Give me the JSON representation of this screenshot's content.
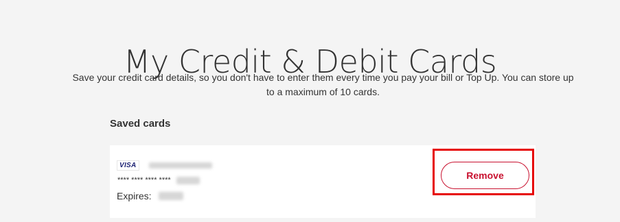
{
  "header": {
    "title": "My Credit & Debit Cards",
    "subtitle": "Save your credit card details, so you don't have to enter them every time you pay your bill or Top Up. You can store up to a maximum of 10 cards."
  },
  "saved_cards": {
    "heading": "Saved cards",
    "cards": [
      {
        "brand": "VISA",
        "masked_number": "**** **** **** ****",
        "expires_label": "Expires:",
        "remove_label": "Remove"
      }
    ]
  },
  "colors": {
    "accent": "#c8102e",
    "highlight": "#e60000",
    "visa_blue": "#1a1f71",
    "background": "#f4f4f4"
  }
}
